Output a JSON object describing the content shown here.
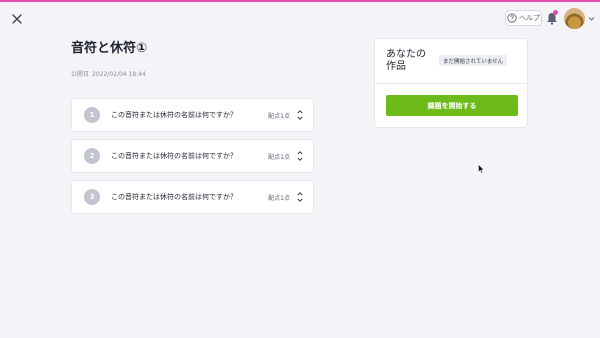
{
  "header": {
    "help_label": "ヘルプ",
    "icons": [
      "close-icon",
      "help-icon",
      "bell-icon",
      "avatar",
      "chevron-down-icon"
    ],
    "accent_color": "#e24fb4"
  },
  "page": {
    "title": "音符と休符①",
    "published_label": "公開日",
    "published_value": "2022/02/04 18:44"
  },
  "questions": [
    {
      "number": "1",
      "text": "この音符または休符の名前は何ですか？",
      "points": "配点1点"
    },
    {
      "number": "2",
      "text": "この音符または休符の名前は何ですか？",
      "points": "配点1点"
    },
    {
      "number": "3",
      "text": "この音符または休符の名前は何ですか？",
      "points": "配点1点"
    }
  ],
  "work_panel": {
    "title": "あなたの作品",
    "status": "まだ開始されていません",
    "start_button": "課題を開始する",
    "button_color": "#6cbb18"
  }
}
